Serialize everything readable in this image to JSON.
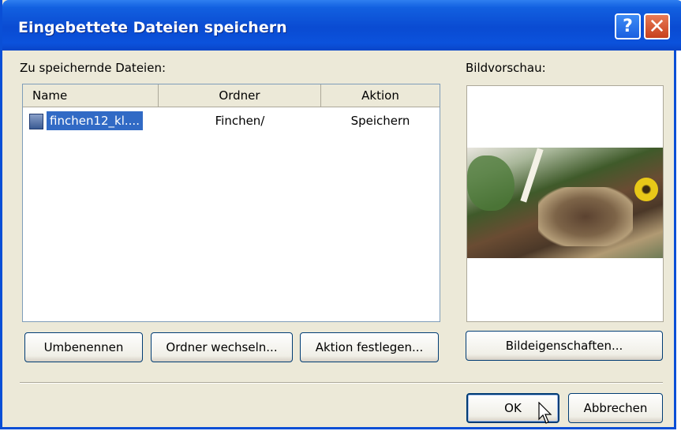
{
  "window": {
    "title": "Eingebettete Dateien speichern",
    "help_label": "?",
    "close_label": "✕"
  },
  "files_label": "Zu speichernde Dateien:",
  "preview_label": "Bildvorschau:",
  "table": {
    "columns": [
      "Name",
      "Ordner",
      "Aktion"
    ],
    "rows": [
      {
        "name": "finchen12_kl....",
        "ordner": "Finchen/",
        "aktion": "Speichern"
      }
    ]
  },
  "buttons": {
    "rename": "Umbenennen",
    "change_folder": "Ordner wechseln...",
    "set_action": "Aktion festlegen...",
    "image_properties": "Bildeigenschaften...",
    "ok": "OK",
    "cancel": "Abbrechen"
  },
  "colors": {
    "titlebar": "#0a4bd2",
    "selection": "#316ac5",
    "dialog_bg": "#ece9d8"
  }
}
